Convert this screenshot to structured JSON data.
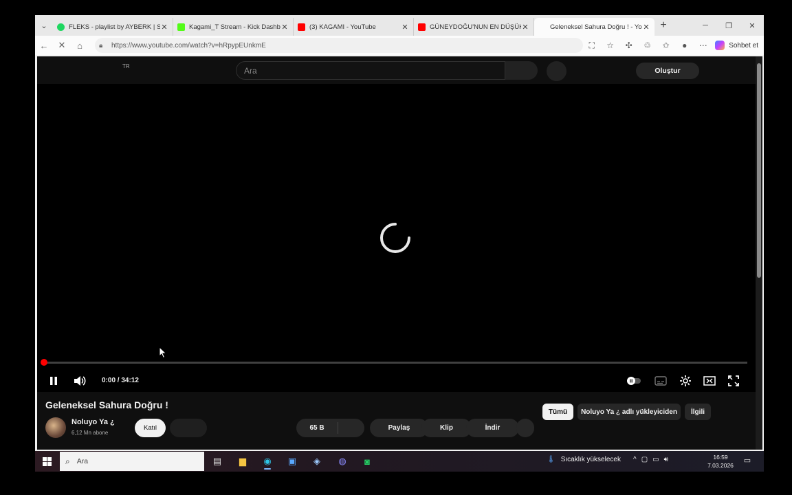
{
  "browser": {
    "tabs": [
      {
        "title": "FLEKS - playlist by AYBERK | Spotif",
        "color": "#1ed760"
      },
      {
        "title": "Kagami_T Stream - Kick Dashboard",
        "color": "#53fc18"
      },
      {
        "title": "(3) KAGAMI - YouTube",
        "color": "#ff0000"
      },
      {
        "title": "GÜNEYDOĞU'NUN EN DÜŞÜK PUA",
        "color": "#ff0000"
      },
      {
        "title": "Geleneksel Sahura Doğru ! - YouT",
        "color": "#ff0000"
      }
    ],
    "url": "https://www.youtube.com/watch?v=hRpypEUnkmE",
    "copilot_label": "Sohbet et"
  },
  "youtube": {
    "country_code": "TR",
    "search_placeholder": "Ara",
    "create_label": "Oluştur",
    "player": {
      "time": "0:00 / 34:12",
      "progress_fraction": 0
    },
    "video": {
      "title": "Geleneksel Sahura Doğru !",
      "channel": "Noluyo Ya ¿",
      "subscribers": "6,12 Mn abone",
      "join_label": "Katıl",
      "likes": "65 B",
      "share_label": "Paylaş",
      "clip_label": "Klip",
      "download_label": "İndir"
    },
    "chips": [
      "Tümü",
      "Noluyo Ya ¿ adlı yükleyiciden",
      "İlgili"
    ]
  },
  "taskbar": {
    "search_placeholder": "Ara",
    "weather": "Sıcaklık yükselecek",
    "time": "16:59",
    "date": "7.03.2026"
  }
}
